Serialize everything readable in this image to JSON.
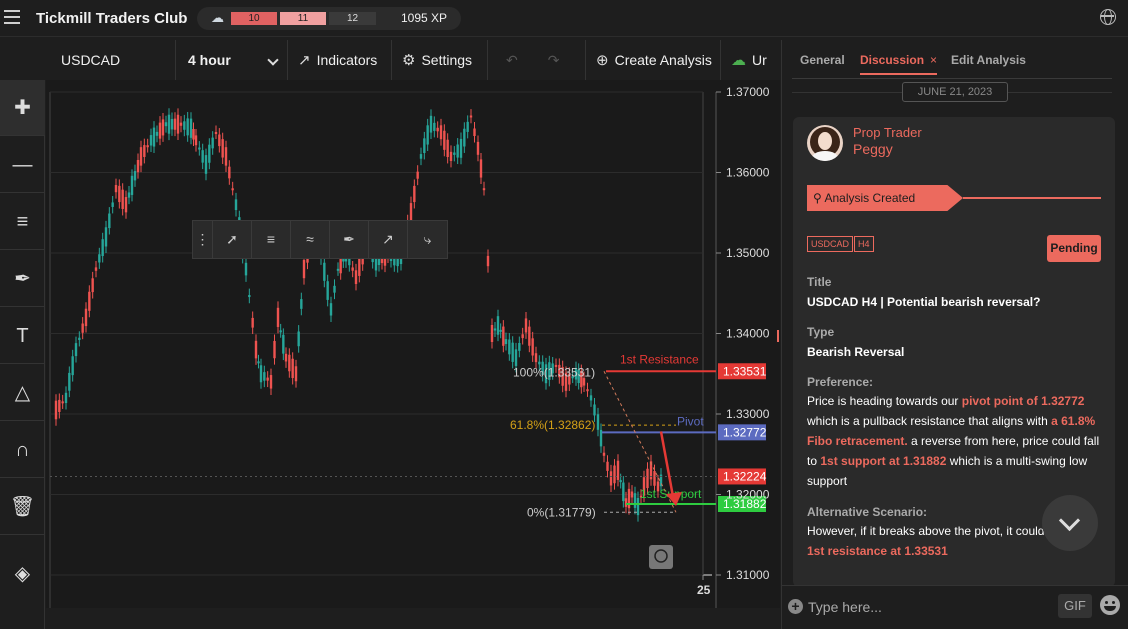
{
  "app": {
    "title": "Tickmill Traders Club",
    "xp_segments": [
      "10",
      "11",
      "12"
    ],
    "xp": "1095 XP"
  },
  "toolbar": {
    "symbol": "USDCAD",
    "timeframe": "4 hour",
    "indicators": "Indicators",
    "settings": "Settings",
    "create": "Create Analysis",
    "truncated": "Ur"
  },
  "left_tools": [
    "crosshair-icon",
    "line-icon",
    "channel-icon",
    "brush-icon",
    "text-icon",
    "pattern-icon",
    "magnet-icon",
    "trash-icon",
    "layers-icon"
  ],
  "chart": {
    "price_ticks": [
      "1.37000",
      "1.36000",
      "1.35000",
      "1.34000",
      "1.33000",
      "1.32000",
      "1.31000"
    ],
    "x_tick": "25",
    "resistance_label": "1st Resistance",
    "resistance_price": "1.33531",
    "pivot_label": "Pivot",
    "pivot_price": "1.32772",
    "current_price": "1.32224",
    "support_label": "1st Support",
    "support_price": "1.31882",
    "fib_100": "100%(1.33531)",
    "fib_618": "61.8%(1.32862)",
    "fib_0": "0%(1.31779)",
    "colors": {
      "up": "#26a69a",
      "down": "#ef5350",
      "resistance": "#e53935",
      "pivot": "#5c6bc0",
      "support": "#2ecc40",
      "fib": "#d4a017"
    }
  },
  "panel": {
    "tabs": [
      "General",
      "Discussion",
      "Edit Analysis"
    ],
    "close": "×",
    "date": "JUNE 21, 2023",
    "role": "Prop Trader",
    "author": "Peggy",
    "banner": "Analysis Created",
    "tags": [
      "USDCAD",
      "H4"
    ],
    "status": "Pending",
    "title_label": "Title",
    "title_value": "USDCAD H4 | Potential bearish reversal?",
    "type_label": "Type",
    "type_value": "Bearish Reversal",
    "pref_label": "Preference:",
    "pref_1": "Price is heading towards our ",
    "pref_2": "pivot point of 1.32772",
    "pref_3": " which is a pullback resistance that aligns with ",
    "pref_4": "a 61.8% Fibo retracement.",
    "pref_5": " a reverse from here, price could fall to ",
    "pref_6": "1st support at 1.31882",
    "pref_7": " which is a multi-swing low support",
    "alt_label": "Alternative Scenario:",
    "alt_1": "However, if it breaks above the pivot, it could",
    "alt_2": "1st resistance at 1.33531",
    "composer_placeholder": "Type here...",
    "gif": "GIF"
  }
}
